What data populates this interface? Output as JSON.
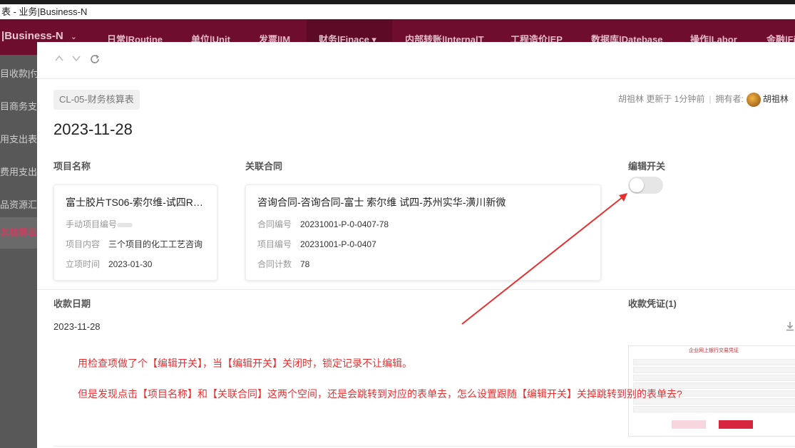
{
  "window": {
    "title": "表 - 业务|Business-N"
  },
  "navbar": {
    "brand": "|Business-N",
    "brand_chevron": "⌄",
    "items": [
      {
        "label": "日常|Routine"
      },
      {
        "label": "单位|Unit"
      },
      {
        "label": "发票|IM"
      },
      {
        "label": "财务|Finace ▾"
      },
      {
        "label": "内部转账|InternalT"
      },
      {
        "label": "工程造价|EP"
      },
      {
        "label": "数据库|Datebase"
      },
      {
        "label": "操作|Labor"
      },
      {
        "label": "金融|Fin"
      }
    ],
    "colors": {
      "bar": "#6e0d2e",
      "active": "#5c0a25"
    }
  },
  "sidebar": {
    "items": [
      {
        "label": "目收款|付"
      },
      {
        "label": "目商务支"
      },
      {
        "label": "用支出表"
      },
      {
        "label": "费用支出表"
      },
      {
        "label": "品资源汇"
      },
      {
        "label": "务核算表"
      }
    ],
    "active_index": 5
  },
  "toolbar": {
    "up_icon": "chevron-up-icon",
    "down_icon": "chevron-down-icon",
    "refresh_icon": "refresh-icon"
  },
  "record": {
    "form_tag": "CL-05-财务核算表",
    "updated_by": "胡祖林 更新于 1分钟前",
    "owner_label": "拥有者:",
    "owner_name": "胡祖林",
    "title": "2023-11-28"
  },
  "project": {
    "label": "项目名称",
    "card_title": "富士胶片TS06-索尔维-试四R…",
    "rows": [
      {
        "key": "手动项目编号",
        "value": ""
      },
      {
        "key": "项目内容",
        "value": "三个项目的化工工艺咨询"
      },
      {
        "key": "立项时间",
        "value": "2023-01-30"
      }
    ]
  },
  "contract": {
    "label": "关联合同",
    "card_title": "咨询合同-咨询合同-富士 索尔维 试四-苏州实华-潢川新微",
    "rows": [
      {
        "key": "合同编号",
        "value": "20231001-P-0-0407-78"
      },
      {
        "key": "项目编号",
        "value": "20231001-P-0-0407"
      },
      {
        "key": "合同计数",
        "value": "78"
      }
    ]
  },
  "edit_switch": {
    "label": "编辑开关",
    "checked": false
  },
  "receipt_date": {
    "label": "收款日期",
    "value": "2023-11-28"
  },
  "receipt_voucher": {
    "label": "收款凭证(1)",
    "doc_title": "企业网上银行交易凭证",
    "download_icon": "download-icon"
  },
  "annotations": {
    "line1": "用检查项做了个【编辑开关】，当【编辑开关】关闭时，锁定记录不让编辑。",
    "line2": "但是发现点击【项目名称】和【关联合同】这两个空间，还是会跳转到对应的表单去，怎么设置跟随【编辑开关】关掉跳转到别的表单去?",
    "color": "#e53030"
  }
}
